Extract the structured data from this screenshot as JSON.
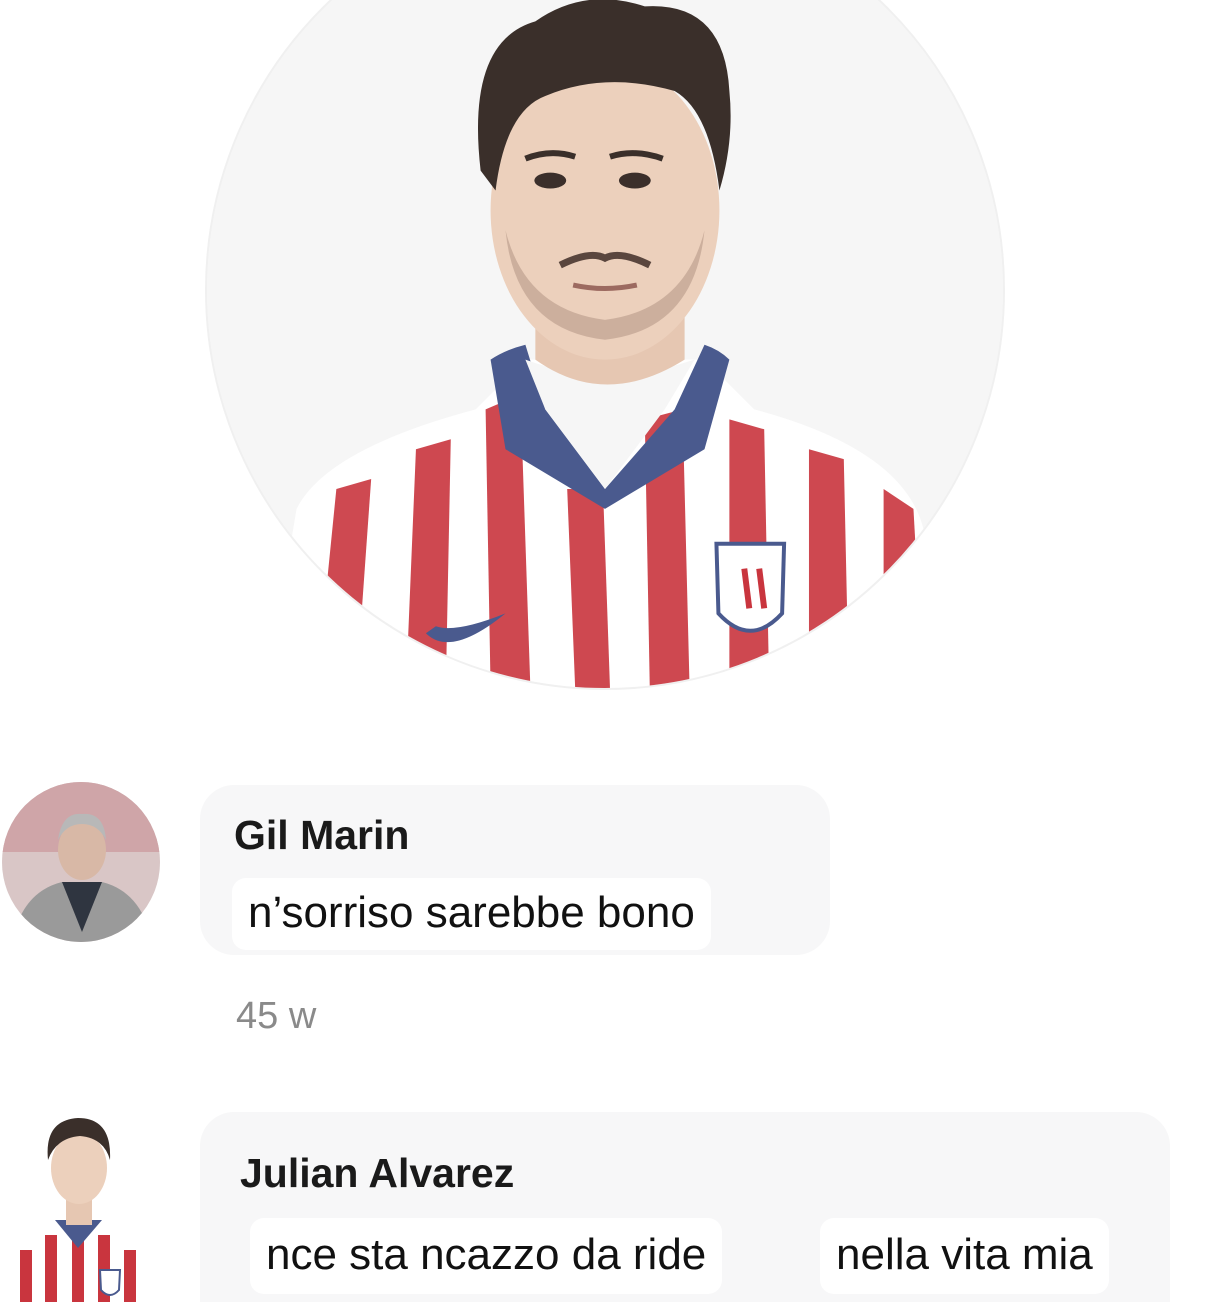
{
  "comments": [
    {
      "author": "Gil Marin",
      "text": "n’sorriso sarebbe bono",
      "time": "45 w"
    },
    {
      "author": "Julian Alvarez",
      "text_part1": "nce sta ncazzo da ride",
      "text_part2": "nella vita mia"
    }
  ],
  "colors": {
    "shirt_red": "#c8303a",
    "collar_blue": "#4a5a8e",
    "bubble_bg": "#f7f7f8"
  }
}
